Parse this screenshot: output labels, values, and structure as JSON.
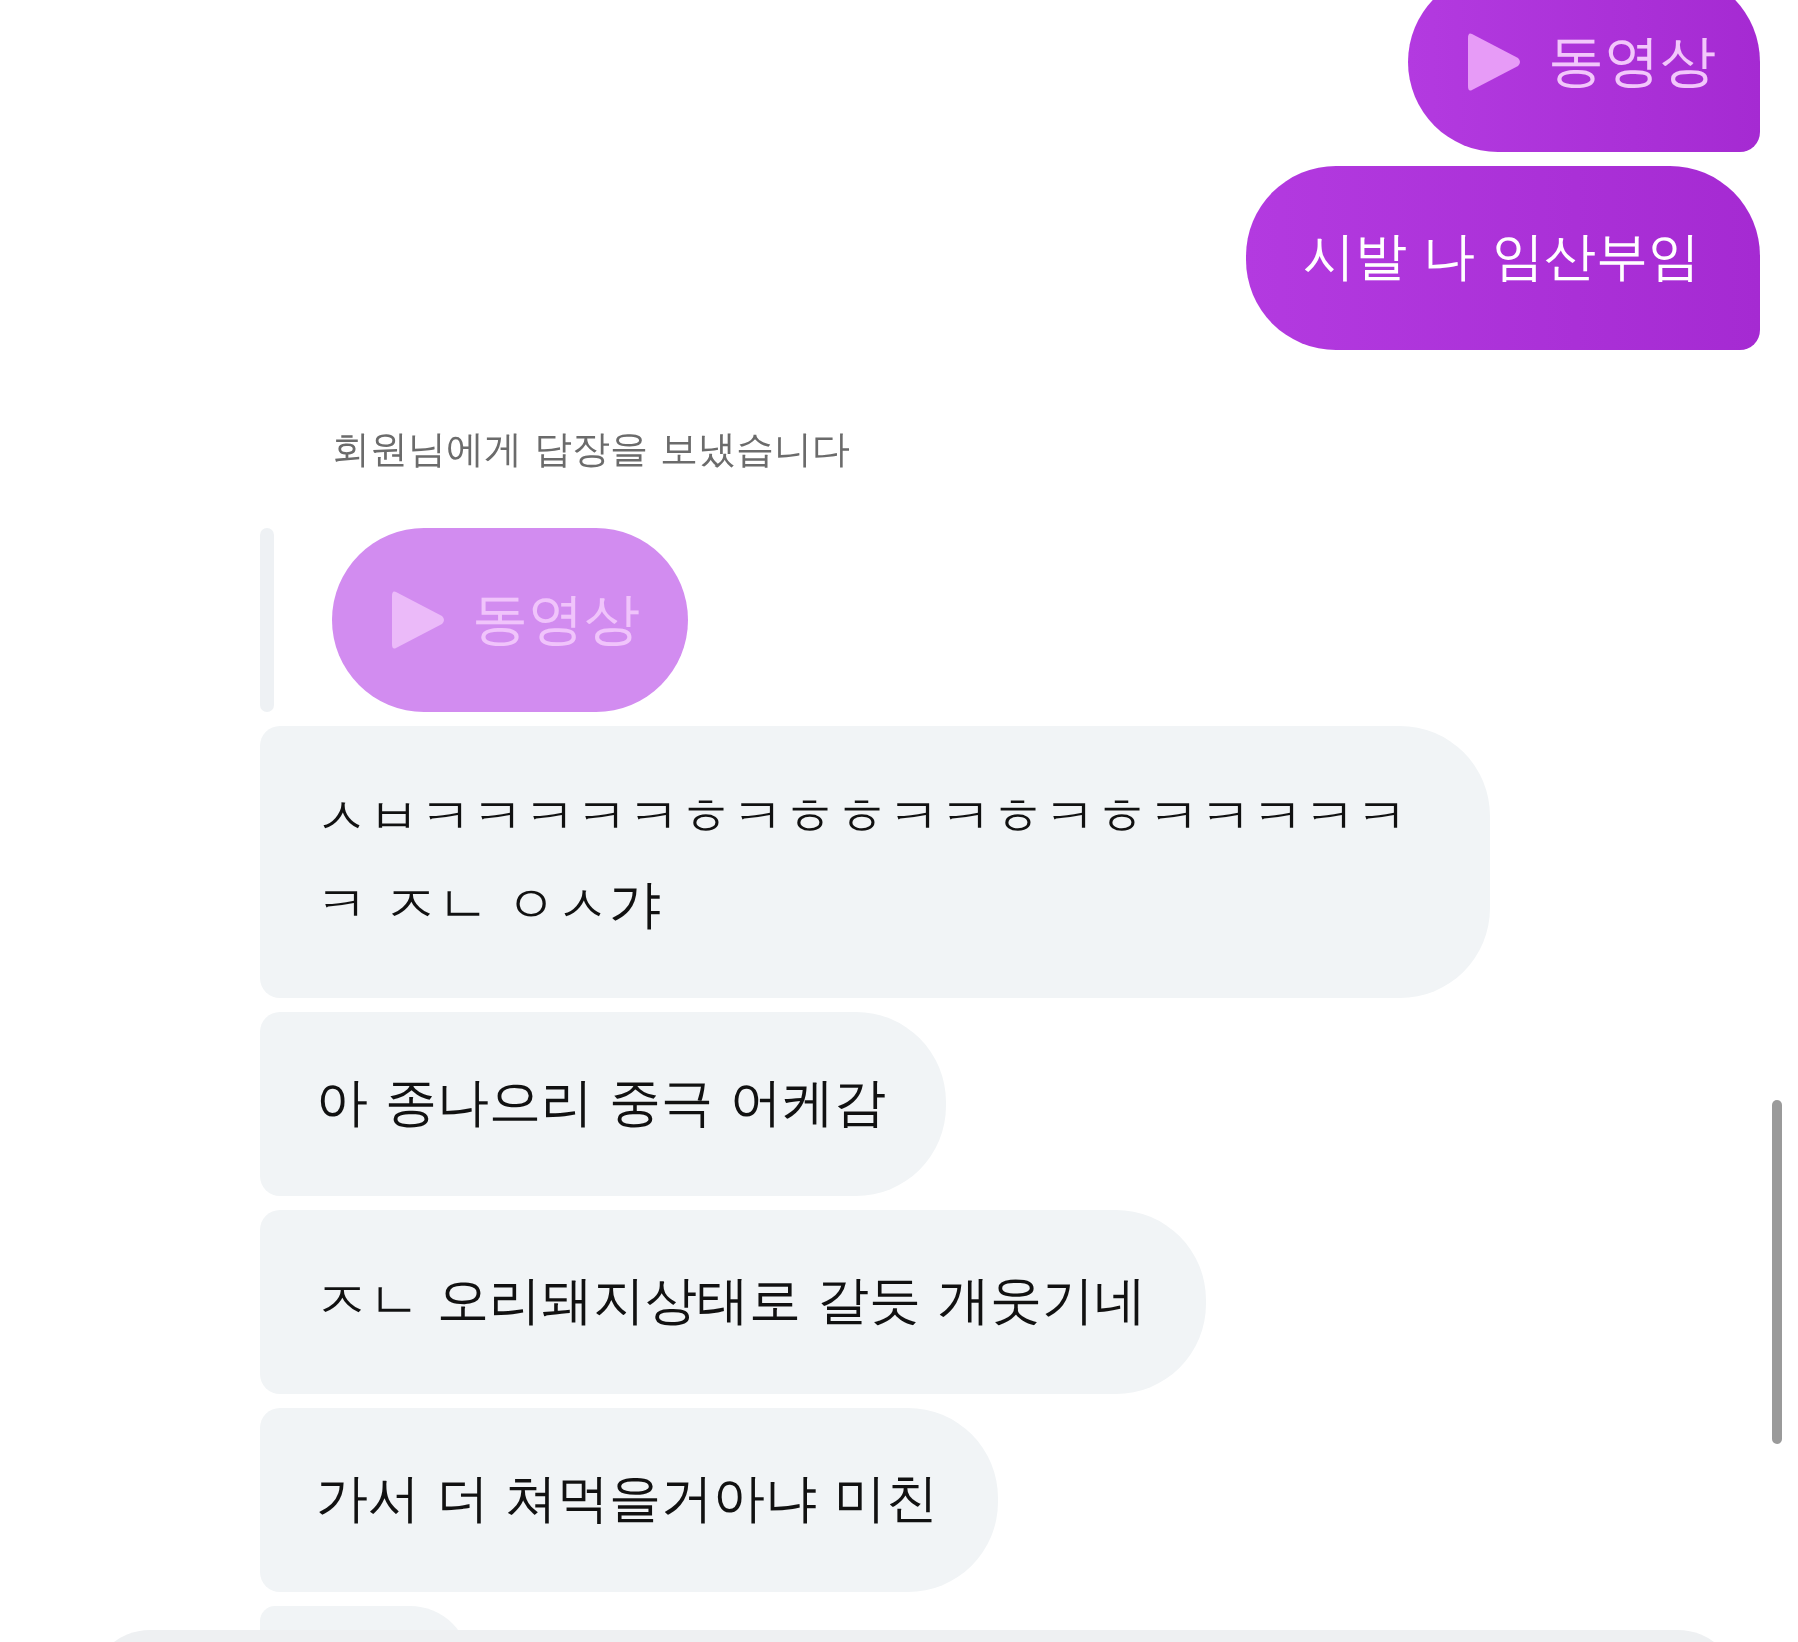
{
  "messages": [
    {
      "kind": "video",
      "sent": true,
      "label": "동영상"
    },
    {
      "kind": "text",
      "sent": true,
      "text": "시발 나 임산부임"
    },
    {
      "kind": "reply",
      "sent": false,
      "note": "회원님에게 답장을 보냈습니다",
      "quoted": {
        "kind": "video",
        "label": "동영상"
      }
    },
    {
      "kind": "text",
      "sent": false,
      "text": "ㅅㅂㅋㅋㅋㅋㅋㅎㅋㅎㅎㅋㅋㅎㅋㅎㅋㅋㅋㅋㅋㅋ ㅈㄴ ㅇㅅ갸"
    },
    {
      "kind": "text",
      "sent": false,
      "text": "아 종나으리 중극 어케감"
    },
    {
      "kind": "text",
      "sent": false,
      "text": "ㅈㄴ 오리돼지상태로 갈듯 개웃기네"
    },
    {
      "kind": "text",
      "sent": false,
      "text": "가서 더 쳐먹을거아냐 미친"
    }
  ]
}
